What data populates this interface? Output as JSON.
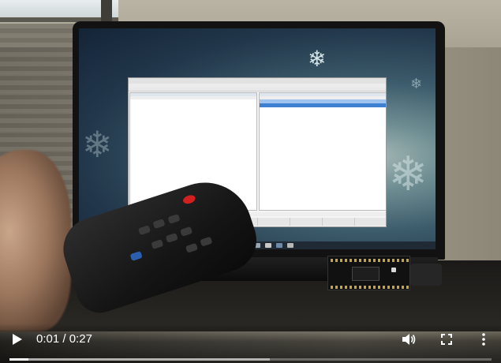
{
  "video": {
    "current_time": "0:01",
    "separator": " / ",
    "duration": "0:27",
    "progress_fraction": 0.04,
    "buffered_fraction": 0.54
  },
  "controls": {
    "play_icon": "play-icon",
    "volume_icon": "volume-icon",
    "fullscreen_icon": "fullscreen-icon",
    "more_icon": "more-options-icon"
  },
  "colors": {
    "progress_played": "#ffffff",
    "remote_power": "#d2201e",
    "selection": "#3d7fd1"
  }
}
